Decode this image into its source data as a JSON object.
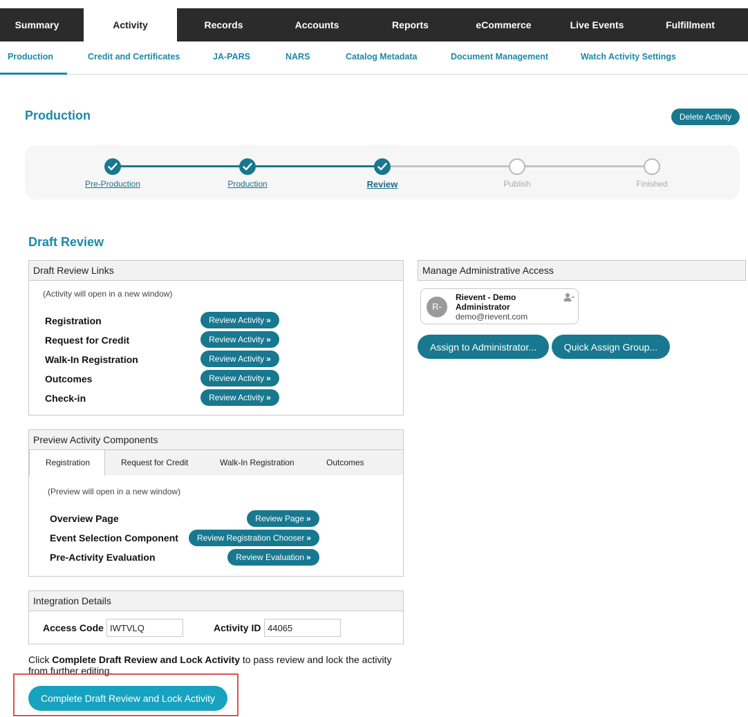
{
  "topnav": [
    "Summary",
    "Activity",
    "Records",
    "Accounts",
    "Reports",
    "eCommerce",
    "Live Events",
    "Fulfillment"
  ],
  "subnav": [
    "Production",
    "Credit and Certificates",
    "JA-PARS",
    "NARS",
    "Catalog Metadata",
    "Document Management",
    "Watch Activity Settings"
  ],
  "page": {
    "title": "Production",
    "delete_label": "Delete Activity"
  },
  "stepper": {
    "steps": [
      "Pre-Production",
      "Production",
      "Review",
      "Publish",
      "Finished"
    ],
    "current": "Review"
  },
  "section_title": "Draft Review",
  "draft_links": {
    "title": "Draft Review Links",
    "note": "(Activity will open in a new window)",
    "button_label": "Review Activity",
    "rows": [
      "Registration",
      "Request for Credit",
      "Walk-In Registration",
      "Outcomes",
      "Check-in"
    ]
  },
  "preview": {
    "title": "Preview Activity Components",
    "tabs": [
      "Registration",
      "Request for Credit",
      "Walk-In Registration",
      "Outcomes"
    ],
    "active_tab": "Registration",
    "note": "(Preview will open in a new window)",
    "rows": [
      {
        "label": "Overview Page",
        "button": "Review Page"
      },
      {
        "label": "Event Selection Component",
        "button": "Review Registration Chooser"
      },
      {
        "label": "Pre-Activity Evaluation",
        "button": "Review Evaluation"
      }
    ]
  },
  "integration": {
    "title": "Integration Details",
    "access_code_label": "Access Code",
    "access_code": "IWTVLQ",
    "activity_id_label": "Activity ID",
    "activity_id": "44065"
  },
  "instructions": {
    "prefix": "Click ",
    "bold": "Complete Draft Review and Lock Activity",
    "suffix": " to pass review and lock the activity from further editing."
  },
  "complete_label": "Complete Draft Review and Lock Activity",
  "admin": {
    "title": "Manage Administrative Access",
    "initials": "R-",
    "name": "Rievent - Demo Administrator",
    "email": "demo@rievent.com",
    "assign_label": "Assign to Administrator...",
    "quick_assign_label": "Quick Assign Group..."
  },
  "colors": {
    "accent": "#1a8aa8",
    "button": "#17788f",
    "complete_button": "#17a2bf",
    "highlight": "#d9534f",
    "nav": "#2b2b2b"
  },
  "icons": {
    "check": "check-icon",
    "remove_user": "remove-user-icon",
    "chevron": "double-chevron-right-icon"
  }
}
